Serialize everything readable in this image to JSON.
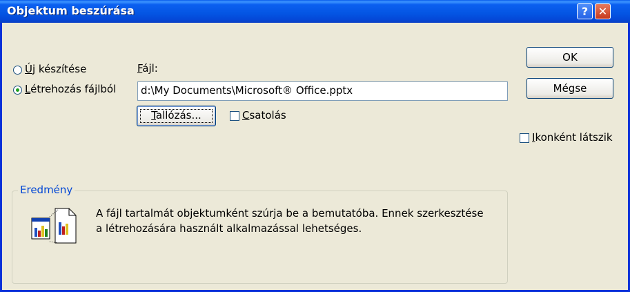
{
  "window": {
    "title": "Objektum beszúrása",
    "help_glyph": "?",
    "close_glyph": "✕"
  },
  "options": {
    "new": {
      "label_ul": "Ú",
      "label_rest": "j készítése",
      "selected": false
    },
    "from_file": {
      "label_ul": "L",
      "label_rest": "étrehozás fájlból",
      "selected": true
    }
  },
  "file": {
    "label_ul": "F",
    "label_rest": "ájl:",
    "value": "d:\\My Documents\\Microsoft® Office.pptx"
  },
  "browse": {
    "label_ul": "T",
    "label_rest": "allózás..."
  },
  "link": {
    "label_ul": "C",
    "label_rest": "satolás",
    "checked": false
  },
  "as_icon": {
    "label_ul": "I",
    "label_rest": "konként látszik",
    "checked": false
  },
  "buttons": {
    "ok": "OK",
    "cancel": "Mégse"
  },
  "result": {
    "label": "Eredmény",
    "line1": "A fájl tartalmát objektumként szúrja be a bemutatóba. Ennek szerkesztése",
    "line2": "a létrehozására használt alkalmazással lehetséges.",
    "icon": "embedded-chart-object-icon"
  },
  "colors": {
    "title_bar": "#0455e3",
    "accent_label": "#0046d5",
    "radio_dot": "#21a121"
  }
}
